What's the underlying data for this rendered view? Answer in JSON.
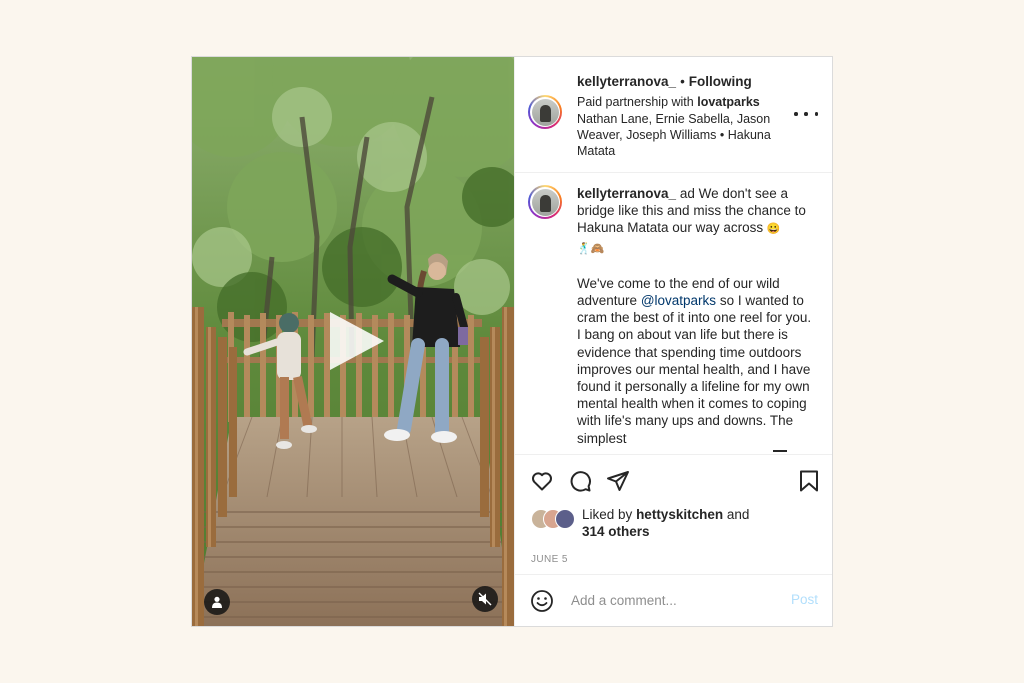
{
  "header": {
    "username": "kellyterranova_",
    "separator": "•",
    "follow_status": "Following",
    "partnership_prefix": "Paid partnership with",
    "partner": "lovatparks",
    "audio": "Nathan Lane, Ernie Sabella, Jason Weaver, Joseph Williams • Hakuna Matata"
  },
  "caption": {
    "username": "kellyterranova_",
    "para1": "ad We don't see a bridge like this and miss the chance to Hakuna Matata our way across",
    "emoji1": "😀",
    "emoji2": "🕺🙈",
    "para2_a": "We've come to the end of our wild adventure",
    "mention": "@lovatparks",
    "para2_b": "so I wanted to cram the best of it into one reel for you. I bang on about van life but there is evidence that spending time outdoors improves our mental health, and I have found it personally a lifeline for my own mental health when it comes to coping with life's many ups and downs. The simplest"
  },
  "likes": {
    "prefix": "Liked by",
    "user": "hettyskitchen",
    "middle": "and",
    "others": "314 others"
  },
  "date": "JUNE 5",
  "comment": {
    "placeholder": "Add a comment...",
    "post_label": "Post"
  },
  "colors": {
    "page_background": "#fbf6ee",
    "mention": "#00376b",
    "post_button_disabled": "#b2dffc",
    "muted_text": "#8e8e8e"
  },
  "icons": {
    "like": "heart-icon",
    "comment": "comment-icon",
    "share": "paper-plane-icon",
    "save": "bookmark-icon",
    "more": "more-horizontal-icon",
    "emoji": "emoji-smile-icon",
    "play": "play-icon",
    "tagged_user": "user-tag-icon",
    "audio": "muted-speaker-icon"
  }
}
